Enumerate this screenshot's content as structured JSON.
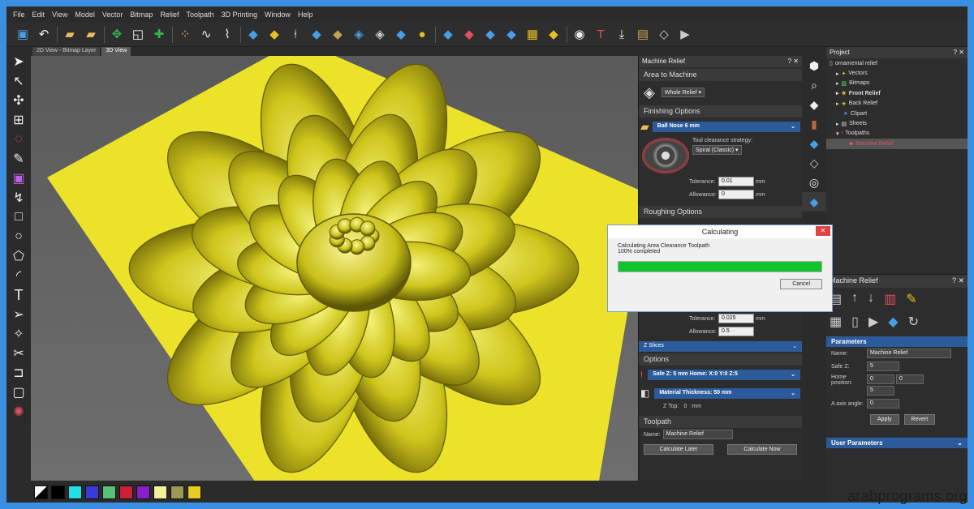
{
  "menu": [
    "File",
    "Edit",
    "View",
    "Model",
    "Vector",
    "Bitmap",
    "Relief",
    "Toolpath",
    "3D Printing",
    "Window",
    "Help"
  ],
  "tabs": {
    "bitmap": "2D View - Bitmap Layer",
    "view3d": "3D View"
  },
  "machine_relief_panel": {
    "title": "Machine Relief",
    "area_section": "Area to Machine",
    "area_value": "Whole Relief",
    "finishing_section": "Finishing Options",
    "finishing_tool": "Ball Nose 6 mm",
    "clearance_label": "Tool clearance strategy:",
    "clearance_value": "Spiral (Classic)",
    "tolerance_label": "Tolerance:",
    "tolerance_value": "0.01",
    "tolerance_unit": "mm",
    "allowance_label": "Allowance:",
    "allowance_value": "0",
    "allowance_unit": "mm",
    "roughing_section": "Roughing Options",
    "rough_tolerance_value": "0.025",
    "rough_tolerance_unit": "mm",
    "rough_allowance_value": "0.5",
    "zslices": "Z Slices",
    "options_section": "Options",
    "safez_text": "Safe Z: 5 mm Home: X:0 Y:0 Z:5",
    "material_text": "Material Thickness: 50 mm",
    "ztop_label": "Z Top:",
    "ztop_value": "0",
    "ztop_unit": "mm",
    "toolpath_section": "Toolpath",
    "name_label": "Name:",
    "name_value": "Machine Relief",
    "calc_later": "Calculate Later",
    "calc_now": "Calculate Now"
  },
  "dialog": {
    "title": "Calculating",
    "message": "Calculating Area Clearance Toolpath",
    "status": "100% completed",
    "progress": 1.0,
    "cancel": "Cancel"
  },
  "project": {
    "title": "Project",
    "items": [
      "ornamental relief",
      "Vectors",
      "Bitmaps",
      "Front Relief",
      "Back Relief",
      "Clipart",
      "Sheets",
      "Toolpaths",
      "Machine Relief"
    ]
  },
  "machine_relief_props": {
    "title": "Machine Relief",
    "params_title": "Parameters",
    "name_label": "Name:",
    "name_value": "Machine Relief",
    "safez_label": "Safe Z:",
    "safez_value": "5",
    "home_label": "Home position:",
    "home_x": "0",
    "home_y": "0",
    "home_z": "5",
    "axis_label": "A axis angle:",
    "axis_value": "0",
    "apply": "Apply",
    "revert": "Revert",
    "user_params": "User Parameters"
  },
  "palette": [
    "#000000",
    "#1fe0e8",
    "#3a3ad8",
    "#59c07a",
    "#cc1f3a",
    "#8a1fc8",
    "#f3ef9a",
    "#9a9a52",
    "#e8cc1f"
  ],
  "accent_colors": {
    "relief": "#d6d21f",
    "progress": "#12c42b",
    "selection": "#2b5b9a"
  },
  "watermark": "arabprograms.org"
}
